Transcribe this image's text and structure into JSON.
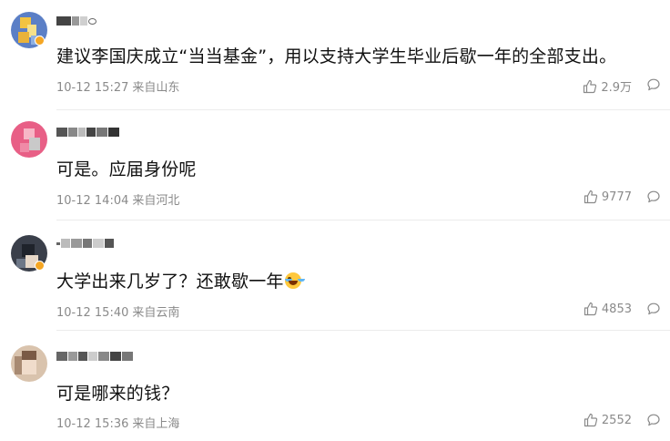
{
  "comments": [
    {
      "username": "",
      "content": "建议李国庆成立“当当基金”，用以支持大学生毕业后歇一年的全部支出。",
      "time": "10-12 15:27",
      "location": "来自山东",
      "likes": "2.9万",
      "has_emoji": false
    },
    {
      "username": "",
      "content": "可是。应届身份呢",
      "time": "10-12 14:04",
      "location": "来自河北",
      "likes": "9777",
      "has_emoji": false
    },
    {
      "username": "",
      "content": "大学出来几岁了？还敢歇一年",
      "time": "10-12 15:40",
      "location": "来自云南",
      "likes": "4853",
      "has_emoji": true,
      "emoji": "laughing-crying"
    },
    {
      "username": "",
      "content": "可是哪来的钱？",
      "time": "10-12 15:36",
      "location": "来自上海",
      "likes": "2552",
      "has_emoji": false
    }
  ],
  "icons": {
    "like": "thumbs-up-icon",
    "reply": "comment-bubble-icon"
  },
  "colors": {
    "meta": "#8a8a8a",
    "content": "#111111",
    "divider": "#ececec"
  }
}
